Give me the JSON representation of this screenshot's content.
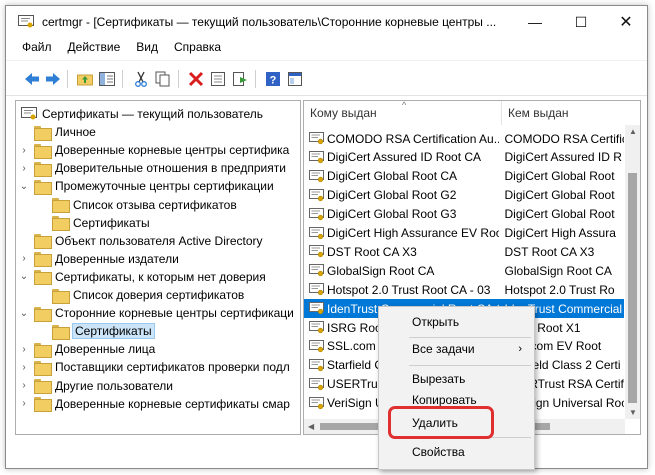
{
  "window": {
    "title": "certmgr - [Сертификаты — текущий пользователь\\Сторонние корневые центры ...",
    "min_glyph": "—",
    "max_glyph": "☐",
    "close_glyph": "✕"
  },
  "menu": [
    "Файл",
    "Действие",
    "Вид",
    "Справка"
  ],
  "toolbar_icons": [
    "back-icon",
    "forward-icon",
    "up-folder-icon",
    "show-hide-tree-icon",
    "cut-icon",
    "copy-icon",
    "delete-icon",
    "properties-icon",
    "export-icon",
    "help-icon",
    "console-icon"
  ],
  "tree": {
    "items": [
      {
        "label": "Сертификаты — текущий пользователь",
        "level": 0,
        "expander": ""
      },
      {
        "label": "Личное",
        "level": 1,
        "expander": ""
      },
      {
        "label": "Доверенные корневые центры сертифика",
        "level": 1,
        "expander": "›"
      },
      {
        "label": "Доверительные отношения в предприяти",
        "level": 1,
        "expander": "›"
      },
      {
        "label": "Промежуточные центры сертификации",
        "level": 1,
        "expander": "⌄"
      },
      {
        "label": "Список отзыва сертификатов",
        "level": 2,
        "expander": ""
      },
      {
        "label": "Сертификаты",
        "level": 2,
        "expander": ""
      },
      {
        "label": "Объект пользователя Active Directory",
        "level": 1,
        "expander": ""
      },
      {
        "label": "Доверенные издатели",
        "level": 1,
        "expander": "›"
      },
      {
        "label": "Сертификаты, к которым нет доверия",
        "level": 1,
        "expander": "⌄"
      },
      {
        "label": "Список доверия сертификатов",
        "level": 2,
        "expander": ""
      },
      {
        "label": "Сторонние корневые центры сертификаци",
        "level": 1,
        "expander": "⌄"
      },
      {
        "label": "Сертификаты",
        "level": 2,
        "expander": "",
        "selected": true
      },
      {
        "label": "Доверенные лица",
        "level": 1,
        "expander": "›"
      },
      {
        "label": "Поставщики сертификатов проверки подл",
        "level": 1,
        "expander": "›"
      },
      {
        "label": "Другие пользователи",
        "level": 1,
        "expander": "›"
      },
      {
        "label": "Доверенные корневые сертификаты смар",
        "level": 1,
        "expander": "›"
      }
    ]
  },
  "list": {
    "columns": [
      "Кому выдан",
      "Кем выдан"
    ],
    "sort_indicator": "^",
    "rows": [
      {
        "a": "COMODO RSA Certification Au...",
        "b": "COMODO RSA Certific"
      },
      {
        "a": "DigiCert Assured ID Root CA",
        "b": "DigiCert Assured ID R"
      },
      {
        "a": "DigiCert Global Root CA",
        "b": "DigiCert Global Root"
      },
      {
        "a": "DigiCert Global Root G2",
        "b": "DigiCert Global Root"
      },
      {
        "a": "DigiCert Global Root G3",
        "b": "DigiCert Global Root"
      },
      {
        "a": "DigiCert High Assurance EV Root ...",
        "b": "DigiCert High Assura"
      },
      {
        "a": "DST Root CA X3",
        "b": "DST Root CA X3"
      },
      {
        "a": "GlobalSign Root CA",
        "b": "GlobalSign Root CA"
      },
      {
        "a": "Hotspot 2.0 Trust Root CA - 03",
        "b": "Hotspot 2.0 Trust Ro"
      },
      {
        "a": "IdenTrust Commercial Root CA 1",
        "b": "IdenTrust Commercial",
        "selected": true
      },
      {
        "a": "ISRG Root X1",
        "b": "ISRG Root X1"
      },
      {
        "a": "SSL.com EV",
        "b": "SSL.com EV Root"
      },
      {
        "a": "Starfield Cl",
        "b": "Starfield Class 2 Certi"
      },
      {
        "a": "USERTrust R",
        "b": "USERTrust RSA Certific"
      },
      {
        "a": "VeriSign Un",
        "b": "VeriSign Universal Roo"
      }
    ]
  },
  "context_menu": {
    "open": "Открыть",
    "all_tasks": "Все задачи",
    "submenu_arrow": "›",
    "cut": "Вырезать",
    "copy": "Копировать",
    "delete": "Удалить",
    "properties": "Свойства"
  },
  "colors": {
    "selection": "#0078d7",
    "highlight": "#e02f2f"
  }
}
